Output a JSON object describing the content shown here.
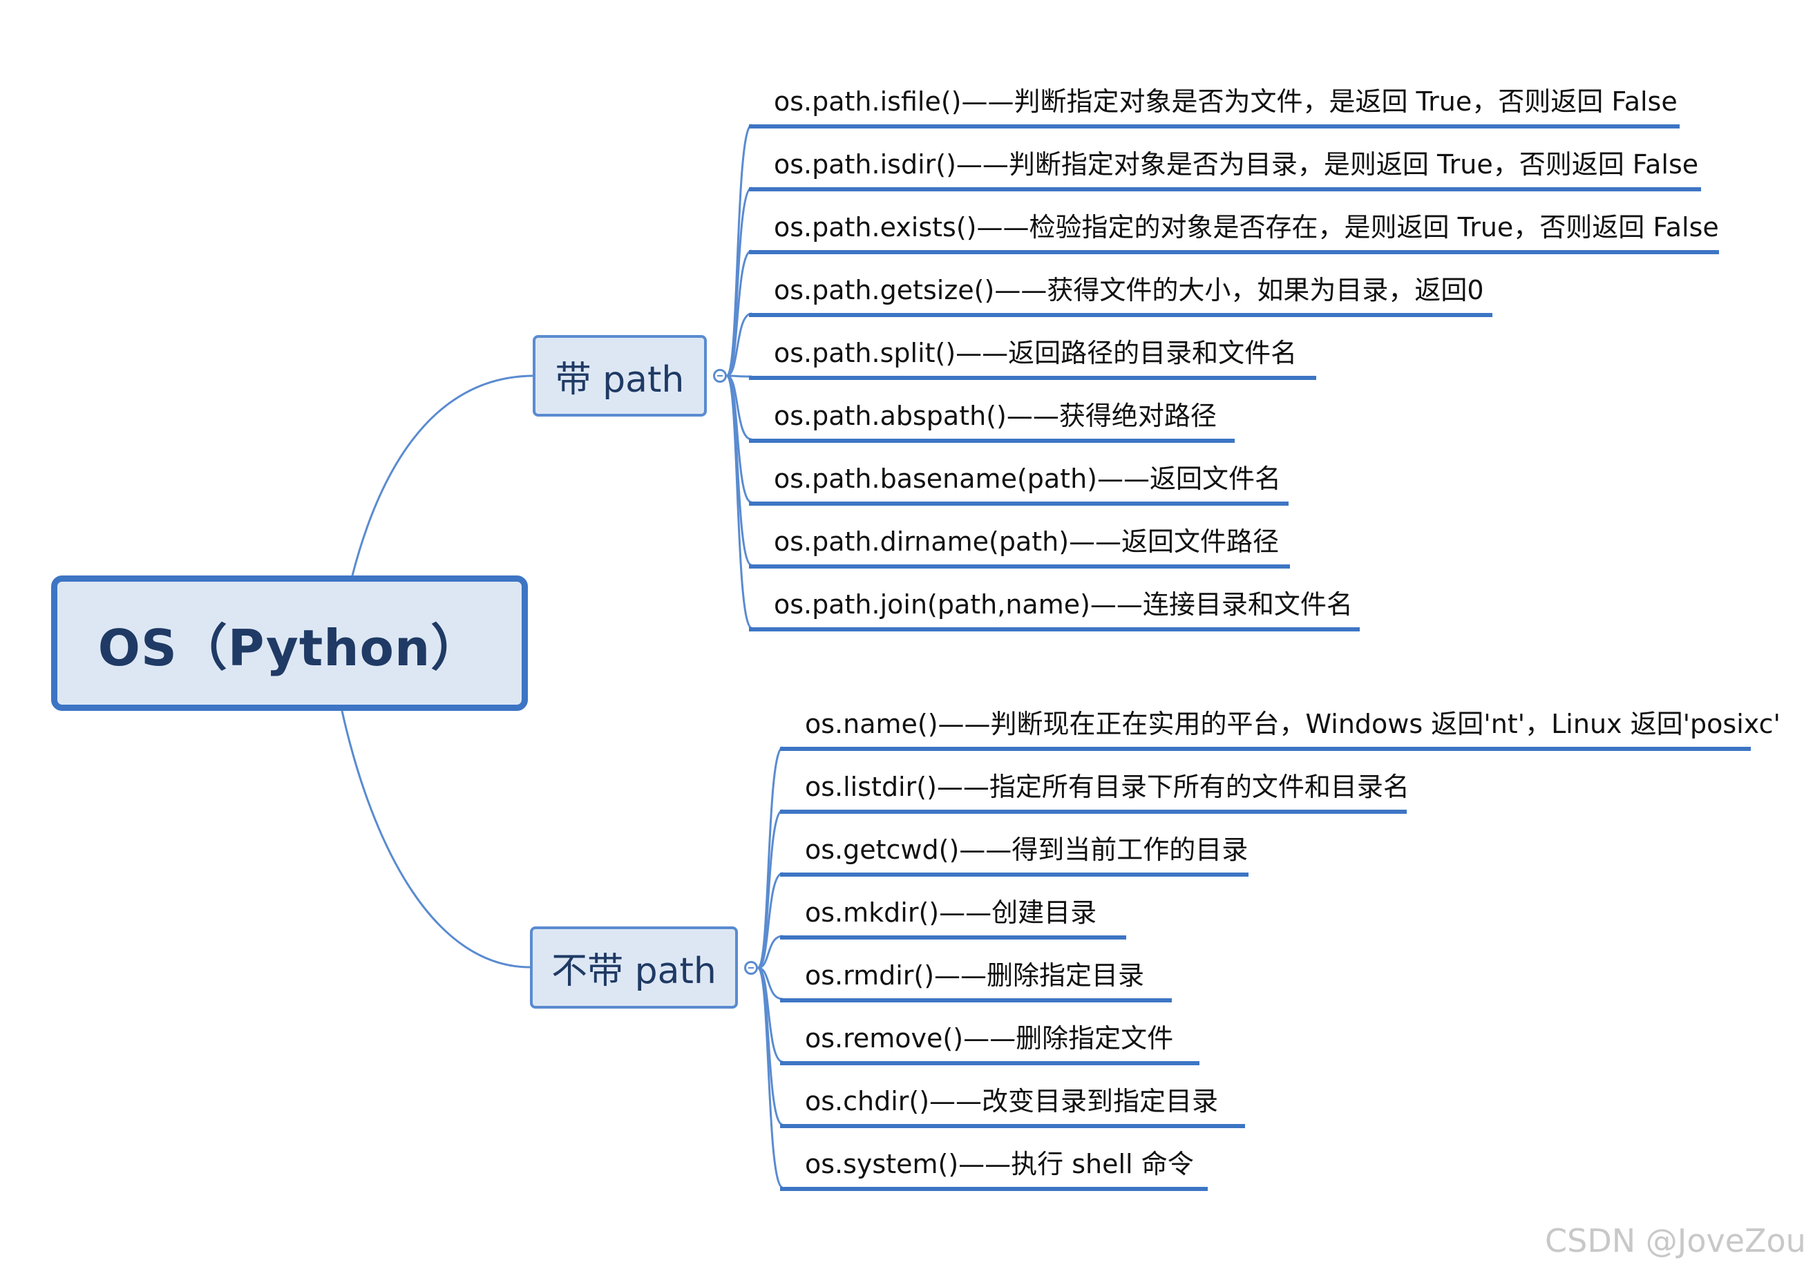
{
  "root": {
    "label": "OS（Python）"
  },
  "branches": [
    {
      "label": "带 path",
      "items": [
        "os.path.isfile()——判断指定对象是否为文件，是返回 True，否则返回 False",
        "os.path.isdir()——判断指定对象是否为目录，是则返回 True，否则返回 False",
        "os.path.exists()——检验指定的对象是否存在，是则返回 True，否则返回 False",
        "os.path.getsize()——获得文件的大小，如果为目录，返回0",
        "os.path.split()——返回路径的目录和文件名",
        "os.path.abspath()——获得绝对路径",
        "os.path.basename(path)——返回文件名",
        "os.path.dirname(path)——返回文件路径",
        "os.path.join(path,name)——连接目录和文件名"
      ]
    },
    {
      "label": "不带 path",
      "items": [
        "os.name()——判断现在正在实用的平台，Windows 返回'nt'，Linux 返回'posixc'",
        "os.listdir()——指定所有目录下所有的文件和目录名",
        "os.getcwd()——得到当前工作的目录",
        "os.mkdir()——创建目录",
        "os.rmdir()——删除指定目录",
        "os.remove()——删除指定文件",
        "os.chdir()——改变目录到指定目录",
        "os.system()——执行 shell 命令"
      ]
    }
  ],
  "watermark": "CSDN @JoveZou"
}
